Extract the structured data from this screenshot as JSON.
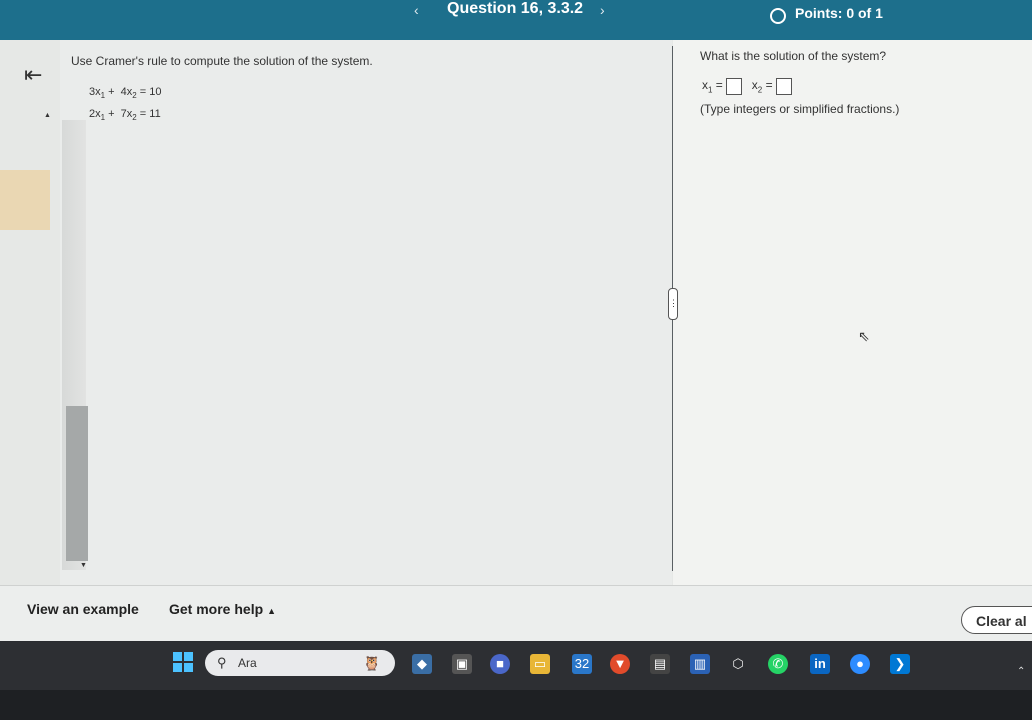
{
  "header": {
    "question_title": "Question 16, 3.3.2",
    "points": "Points: 0 of 1",
    "prev_glyph": "‹",
    "next_glyph": "›"
  },
  "left": {
    "instruction": "Use Cramer's rule to compute the solution of the system.",
    "equations": [
      {
        "a": "3",
        "b": "4",
        "rhs": "10"
      },
      {
        "a": "2",
        "b": "7",
        "rhs": "11"
      }
    ]
  },
  "right": {
    "question": "What is the solution of the system?",
    "x1_label": "x",
    "x1_sub": "1",
    "x2_label": "x",
    "x2_sub": "2",
    "x1_value": "",
    "x2_value": "",
    "hint": "(Type integers or simplified fractions.)"
  },
  "bottom": {
    "view_example": "View an example",
    "get_help": "Get more help",
    "clear_all": "Clear al"
  },
  "taskbar": {
    "search_text": "Ara",
    "icons": [
      "widgets-icon",
      "terminal-icon",
      "chat-icon",
      "file-explorer-icon",
      "store-icon",
      "brave-icon",
      "photo-icon",
      "remote-icon",
      "package-icon",
      "whatsapp-icon",
      "linkedin-icon",
      "zoom-icon",
      "vscode-icon"
    ],
    "store_badge": "32"
  },
  "colors": {
    "header": "#1d6f8c",
    "gutter_highlight": "#ead7b3",
    "windows_blue": "#4cc2ff"
  }
}
